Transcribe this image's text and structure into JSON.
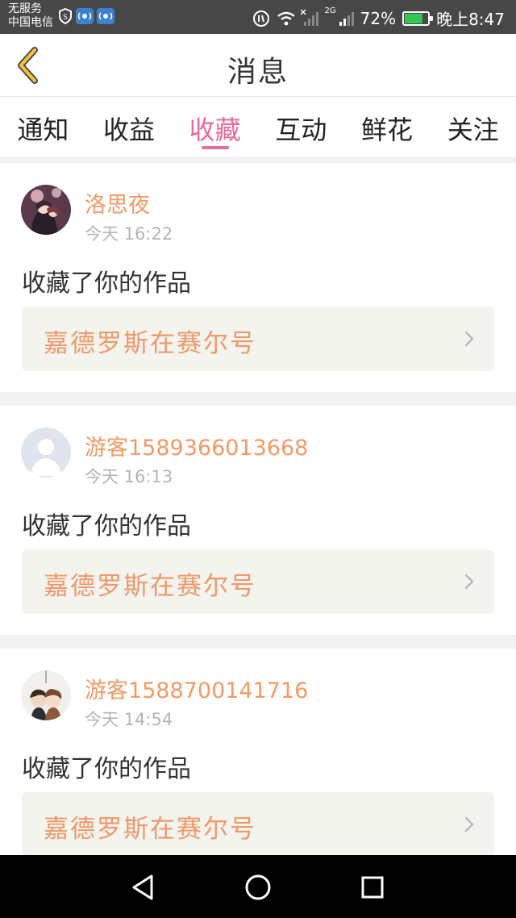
{
  "status_bar": {
    "carrier_line1": "无服务",
    "carrier_line2": "中国电信",
    "signal_label": "2G",
    "battery": "72%",
    "battery_level": 0.72,
    "time": "晚上8:47",
    "icons": [
      "shield-icon",
      "vpn-icon",
      "vpn-icon",
      "data-icon",
      "wifi-icon",
      "signal-icon",
      "battery-icon"
    ]
  },
  "header": {
    "title": "消息",
    "back_icon": "chevron-left-icon"
  },
  "tabs": [
    {
      "label": "通知",
      "active": false
    },
    {
      "label": "收益",
      "active": false
    },
    {
      "label": "收藏",
      "active": true
    },
    {
      "label": "互动",
      "active": false
    },
    {
      "label": "鲜花",
      "active": false
    },
    {
      "label": "关注",
      "active": false
    }
  ],
  "messages": [
    {
      "user": "洛思夜",
      "time": "今天 16:22",
      "action": "收藏了你的作品",
      "work": "嘉德罗斯在赛尔号",
      "avatar": "anime-avatar"
    },
    {
      "user": "游客1589366013668",
      "time": "今天 16:13",
      "action": "收藏了你的作品",
      "work": "嘉德罗斯在赛尔号",
      "avatar": "default-user-avatar"
    },
    {
      "user": "游客1588700141716",
      "time": "今天 14:54",
      "action": "收藏了你的作品",
      "work": "嘉德罗斯在赛尔号",
      "avatar": "chibi-avatar"
    }
  ],
  "nav_bar": {
    "icons": [
      "back-triangle-icon",
      "home-circle-icon",
      "recent-square-icon"
    ]
  },
  "colors": {
    "accent_pink": "#e8699a",
    "username_orange": "#f29a66",
    "work_title_orange": "#f0986a",
    "work_box_bg": "#f4f4ee"
  }
}
